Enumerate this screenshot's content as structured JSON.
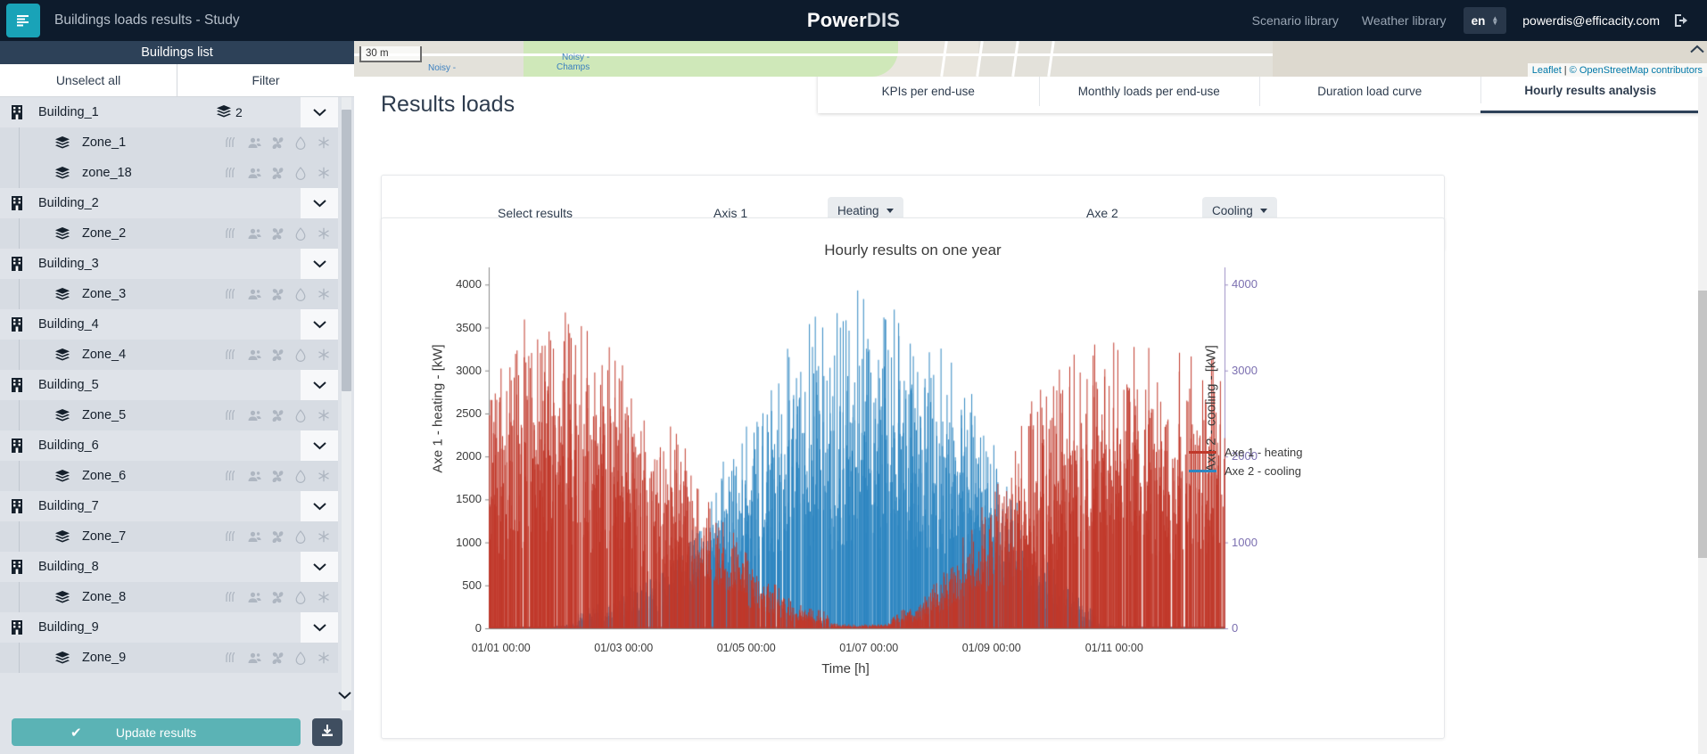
{
  "topbar": {
    "menu_icon": "hamburger-list-icon",
    "app_title": "Buildings loads results - Study",
    "logo_part1": "Power",
    "logo_part2": "DIS",
    "links": [
      {
        "label": "Scenario library",
        "name": "scenario-library-link"
      },
      {
        "label": "Weather library",
        "name": "weather-library-link"
      }
    ],
    "language": "en",
    "user_email": "powerdis@efficacity.com",
    "logout_icon": "logout-icon",
    "bg_color": "#0d1b2c",
    "accent_color": "#19a3b8"
  },
  "sidebar": {
    "header": "Buildings list",
    "unselect_all": "Unselect all",
    "filter": "Filter",
    "update_button": "Update results",
    "download_icon": "download-icon",
    "check_icon": "check-icon",
    "buildings": [
      {
        "label": "Building_1",
        "count": "2",
        "zones": [
          {
            "label": "Zone_1"
          },
          {
            "label": "zone_18"
          }
        ]
      },
      {
        "label": "Building_2",
        "count": "",
        "zones": [
          {
            "label": "Zone_2"
          }
        ]
      },
      {
        "label": "Building_3",
        "count": "",
        "zones": [
          {
            "label": "Zone_3"
          }
        ]
      },
      {
        "label": "Building_4",
        "count": "",
        "zones": [
          {
            "label": "Zone_4"
          }
        ]
      },
      {
        "label": "Building_5",
        "count": "",
        "zones": [
          {
            "label": "Zone_5"
          }
        ]
      },
      {
        "label": "Building_6",
        "count": "",
        "zones": [
          {
            "label": "Zone_6"
          }
        ]
      },
      {
        "label": "Building_7",
        "count": "",
        "zones": [
          {
            "label": "Zone_7"
          }
        ]
      },
      {
        "label": "Building_8",
        "count": "",
        "zones": [
          {
            "label": "Zone_8"
          }
        ]
      },
      {
        "label": "Building_9",
        "count": "",
        "zones": [
          {
            "label": "Zone_9"
          }
        ]
      }
    ],
    "zone_icon_names": [
      "heating-icon",
      "occupancy-icon",
      "fan-icon",
      "water-drop-icon",
      "snowflake-icon",
      "dhw-icon"
    ]
  },
  "map": {
    "scale_label": "30 m",
    "labels": [
      "Noisy -",
      "Noisy -",
      "Champs"
    ],
    "attribution_leaflet": "Leaflet",
    "attribution_sep": "|",
    "attribution_osm": "© OpenStreetMap contributors",
    "collapse_icon": "chevron-up-icon"
  },
  "main": {
    "page_title": "Results loads",
    "tabs": [
      {
        "label": "KPIs per end-use",
        "active": false
      },
      {
        "label": "Monthly loads per end-use",
        "active": false
      },
      {
        "label": "Duration load curve",
        "active": false
      },
      {
        "label": "Hourly results analysis",
        "active": true
      }
    ],
    "select_panel": {
      "title": "Select results",
      "axis1_label": "Axis 1",
      "axis1_value": "Heating",
      "axis2_label": "Axe 2",
      "axis2_value": "Cooling"
    }
  },
  "chart_data": {
    "type": "line",
    "title": "Hourly results on one year",
    "xlabel": "Time [h]",
    "ylabel": "Axe 1 - heating - [kW]",
    "y2label": "Axe 2 - cooling - [kW]",
    "grid": false,
    "legend_position": "right",
    "series": [
      {
        "name": "Axe 1 - heating",
        "color": "#c0392b",
        "axis": "left"
      },
      {
        "name": "Axe 2 - cooling",
        "color": "#2e86c1",
        "axis": "right"
      }
    ],
    "ylim": [
      0,
      4200
    ],
    "yticks": [
      0,
      500,
      1000,
      1500,
      2000,
      2500,
      3000,
      3500,
      4000
    ],
    "y2lim": [
      0,
      4200
    ],
    "y2ticks": [
      0,
      1000,
      2000,
      3000,
      4000
    ],
    "y2tick_color": "#7b6fb0",
    "xticks": [
      "01/01 00:00",
      "01/03 00:00",
      "01/05 00:00",
      "01/07 00:00",
      "01/09 00:00",
      "01/11 00:00"
    ],
    "xlim_months": [
      1,
      12
    ],
    "heating_monthly_peaks": [
      3100,
      4050,
      3500,
      2400,
      1100,
      300,
      120,
      260,
      1400,
      2900,
      3700,
      3350
    ],
    "cooling_monthly_peaks": [
      60,
      80,
      350,
      900,
      2300,
      3500,
      4050,
      3800,
      2600,
      900,
      120,
      70
    ],
    "note": "Two interleaved dense hourly spike series over one year; heating (red, left axis) peaks in winter months, cooling (blue, right axis) peaks in summer months."
  }
}
